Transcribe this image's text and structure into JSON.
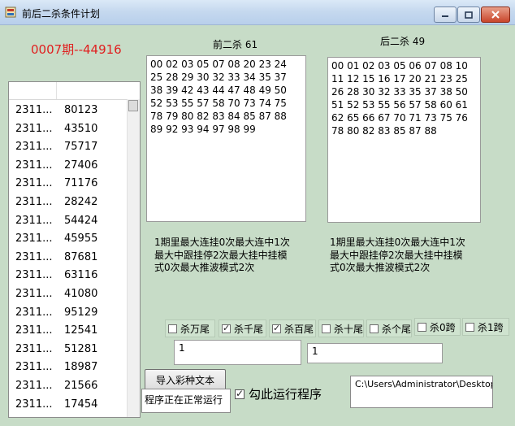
{
  "window": {
    "title": "前后二杀条件计划"
  },
  "period_label": "0007期--44916",
  "list": {
    "rows": [
      {
        "c1": "2311...",
        "c2": "80123"
      },
      {
        "c1": "2311...",
        "c2": "43510"
      },
      {
        "c1": "2311...",
        "c2": "75717"
      },
      {
        "c1": "2311...",
        "c2": "27406"
      },
      {
        "c1": "2311...",
        "c2": "71176"
      },
      {
        "c1": "2311...",
        "c2": "28242"
      },
      {
        "c1": "2311...",
        "c2": "54424"
      },
      {
        "c1": "2311...",
        "c2": "45955"
      },
      {
        "c1": "2311...",
        "c2": "87681"
      },
      {
        "c1": "2311...",
        "c2": "63116"
      },
      {
        "c1": "2311...",
        "c2": "41080"
      },
      {
        "c1": "2311...",
        "c2": "95129"
      },
      {
        "c1": "2311...",
        "c2": "12541"
      },
      {
        "c1": "2311...",
        "c2": "51281"
      },
      {
        "c1": "2311...",
        "c2": "18987"
      },
      {
        "c1": "2311...",
        "c2": "21566"
      },
      {
        "c1": "2311...",
        "c2": "17454"
      }
    ]
  },
  "front": {
    "title": "前二杀 61",
    "numbers": "00 02 03 05 07 08 20 23 24 25 28 29 30 32 33 34 35 37 38 39 42 43 44 47 48 49 50 52 53 55 57 58 70 73 74 75 78 79 80 82 83 84 85 87 88 89 92 93 94 97 98 99",
    "stats": [
      "1期里最大连挂0次最大连中1次",
      "最大中跟挂停2次最大挂中挂模",
      "式0次最大推波模式2次"
    ]
  },
  "back": {
    "title": "后二杀 49",
    "numbers": "00 01 02 03 05 06 07 08 10 11 12 15 16 17 20 21 23 25 26 28 30 32 33 35 37 38 50 51 52 53 55 56 57 58 60 61 62 65 66 67 70 71 73 75 76 78 80 82 83 85 87 88",
    "stats": [
      "1期里最大连挂0次最大连中1次",
      "最大中跟挂停2次最大挂中挂模",
      "式0次最大推波模式2次"
    ]
  },
  "checkboxes": [
    {
      "label": "杀万尾",
      "checked": false
    },
    {
      "label": "杀千尾",
      "checked": true
    },
    {
      "label": "杀百尾",
      "checked": true
    },
    {
      "label": "杀十尾",
      "checked": false
    },
    {
      "label": "杀个尾",
      "checked": false
    },
    {
      "label": "杀0跨",
      "checked": false
    },
    {
      "label": "杀1跨",
      "checked": false
    }
  ],
  "inputs": {
    "left_value": "1",
    "right_value": "1"
  },
  "import_button": "导入彩种文本",
  "status_text": "程序正在正常运行",
  "run_checkbox": {
    "label": "勾此运行程序",
    "checked": true
  },
  "path_text": "C:\\Users\\Administrator\\Desktop"
}
